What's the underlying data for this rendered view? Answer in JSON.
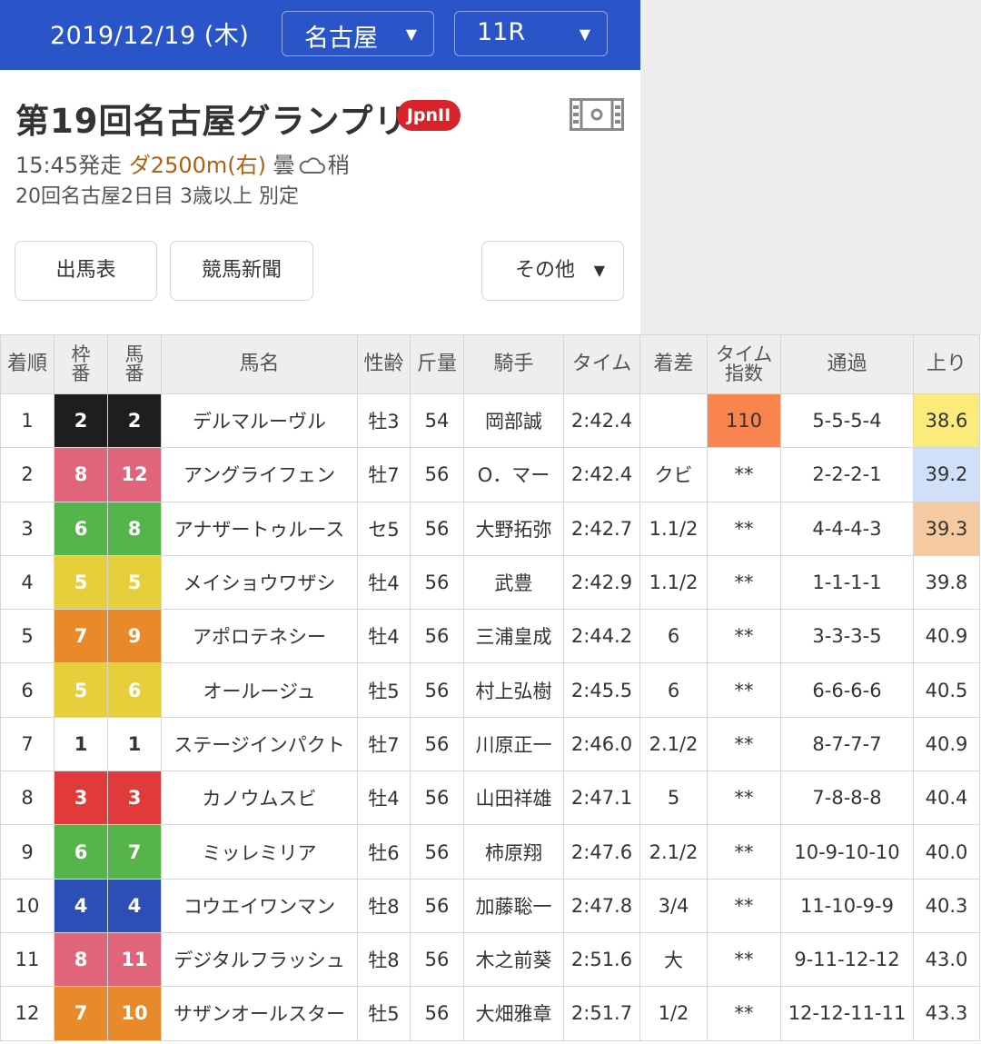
{
  "header": {
    "date": "2019/12/19 (木)",
    "venue": "名古屋",
    "race_number": "11R"
  },
  "race": {
    "title": "第19回名古屋グランプリ",
    "grade": "JpnII",
    "start": "15:45発走",
    "course": "ダ2500m(右)",
    "weather": "曇",
    "track_condition": "稍",
    "meeting": "20回名古屋2日目",
    "condition": "3歳以上 別定"
  },
  "buttons": {
    "entries": "出馬表",
    "newspaper": "競馬新聞",
    "other": "その他"
  },
  "table": {
    "headers": {
      "rank": "着順",
      "waku": "枠番",
      "umaban": "馬番",
      "name": "馬名",
      "sexage": "性齢",
      "weight": "斤量",
      "jockey": "騎手",
      "time": "タイム",
      "margin": "着差",
      "time_index": "タイム指数",
      "passing": "通過",
      "last3f": "上り"
    },
    "rows": [
      {
        "rank": "1",
        "waku": "2",
        "umaban": "2",
        "name": "デルマルーヴル",
        "sexage": "牡3",
        "weight": "54",
        "jockey": "岡部誠",
        "time": "2:42.4",
        "margin": "",
        "time_index": "110",
        "passing": "5-5-5-4",
        "last3f": "38.6"
      },
      {
        "rank": "2",
        "waku": "8",
        "umaban": "12",
        "name": "アングライフェン",
        "sexage": "牡7",
        "weight": "56",
        "jockey": "O．マー",
        "time": "2:42.4",
        "margin": "クビ",
        "time_index": "**",
        "passing": "2-2-2-1",
        "last3f": "39.2"
      },
      {
        "rank": "3",
        "waku": "6",
        "umaban": "8",
        "name": "アナザートゥルース",
        "sexage": "セ5",
        "weight": "56",
        "jockey": "大野拓弥",
        "time": "2:42.7",
        "margin": "1.1/2",
        "time_index": "**",
        "passing": "4-4-4-3",
        "last3f": "39.3"
      },
      {
        "rank": "4",
        "waku": "5",
        "umaban": "5",
        "name": "メイショウワザシ",
        "sexage": "牡4",
        "weight": "56",
        "jockey": "武豊",
        "time": "2:42.9",
        "margin": "1.1/2",
        "time_index": "**",
        "passing": "1-1-1-1",
        "last3f": "39.8"
      },
      {
        "rank": "5",
        "waku": "7",
        "umaban": "9",
        "name": "アポロテネシー",
        "sexage": "牡4",
        "weight": "56",
        "jockey": "三浦皇成",
        "time": "2:44.2",
        "margin": "6",
        "time_index": "**",
        "passing": "3-3-3-5",
        "last3f": "40.9"
      },
      {
        "rank": "6",
        "waku": "5",
        "umaban": "6",
        "name": "オールージュ",
        "sexage": "牡5",
        "weight": "56",
        "jockey": "村上弘樹",
        "time": "2:45.5",
        "margin": "6",
        "time_index": "**",
        "passing": "6-6-6-6",
        "last3f": "40.5"
      },
      {
        "rank": "7",
        "waku": "1",
        "umaban": "1",
        "name": "ステージインパクト",
        "sexage": "牡7",
        "weight": "56",
        "jockey": "川原正一",
        "time": "2:46.0",
        "margin": "2.1/2",
        "time_index": "**",
        "passing": "8-7-7-7",
        "last3f": "40.9"
      },
      {
        "rank": "8",
        "waku": "3",
        "umaban": "3",
        "name": "カノウムスビ",
        "sexage": "牡4",
        "weight": "56",
        "jockey": "山田祥雄",
        "time": "2:47.1",
        "margin": "5",
        "time_index": "**",
        "passing": "7-8-8-8",
        "last3f": "40.4"
      },
      {
        "rank": "9",
        "waku": "6",
        "umaban": "7",
        "name": "ミッレミリア",
        "sexage": "牡6",
        "weight": "56",
        "jockey": "柿原翔",
        "time": "2:47.6",
        "margin": "2.1/2",
        "time_index": "**",
        "passing": "10-9-10-10",
        "last3f": "40.0"
      },
      {
        "rank": "10",
        "waku": "4",
        "umaban": "4",
        "name": "コウエイワンマン",
        "sexage": "牡8",
        "weight": "56",
        "jockey": "加藤聡一",
        "time": "2:47.8",
        "margin": "3/4",
        "time_index": "**",
        "passing": "11-10-9-9",
        "last3f": "40.3"
      },
      {
        "rank": "11",
        "waku": "8",
        "umaban": "11",
        "name": "デジタルフラッシュ",
        "sexage": "牡8",
        "weight": "56",
        "jockey": "木之前葵",
        "time": "2:51.6",
        "margin": "大",
        "time_index": "**",
        "passing": "9-11-12-12",
        "last3f": "43.0"
      },
      {
        "rank": "12",
        "waku": "7",
        "umaban": "10",
        "name": "サザンオールスター",
        "sexage": "牡5",
        "weight": "56",
        "jockey": "大畑雅章",
        "time": "2:51.7",
        "margin": "1/2",
        "time_index": "**",
        "passing": "12-12-11-11",
        "last3f": "43.3"
      }
    ]
  },
  "colors": {
    "header_bar": "#2a55c9",
    "grade_badge": "#d8232a",
    "link": "#1a3fb5",
    "waku": {
      "1": {
        "bg": "#ffffff",
        "fg": "#333333"
      },
      "2": {
        "bg": "#1e1e1e",
        "fg": "#ffffff"
      },
      "3": {
        "bg": "#e03a3a",
        "fg": "#ffffff"
      },
      "4": {
        "bg": "#2b4fb5",
        "fg": "#ffffff"
      },
      "5": {
        "bg": "#e6cf3a",
        "fg": "#ffffff"
      },
      "6": {
        "bg": "#56b54a",
        "fg": "#ffffff"
      },
      "7": {
        "bg": "#e88a2a",
        "fg": "#ffffff"
      },
      "8": {
        "bg": "#e0647a",
        "fg": "#ffffff"
      }
    },
    "time_index_top": "#f8844e",
    "last3f_rank": [
      "#fbeb7a",
      "#cfe0f8",
      "#f5caa0"
    ]
  }
}
